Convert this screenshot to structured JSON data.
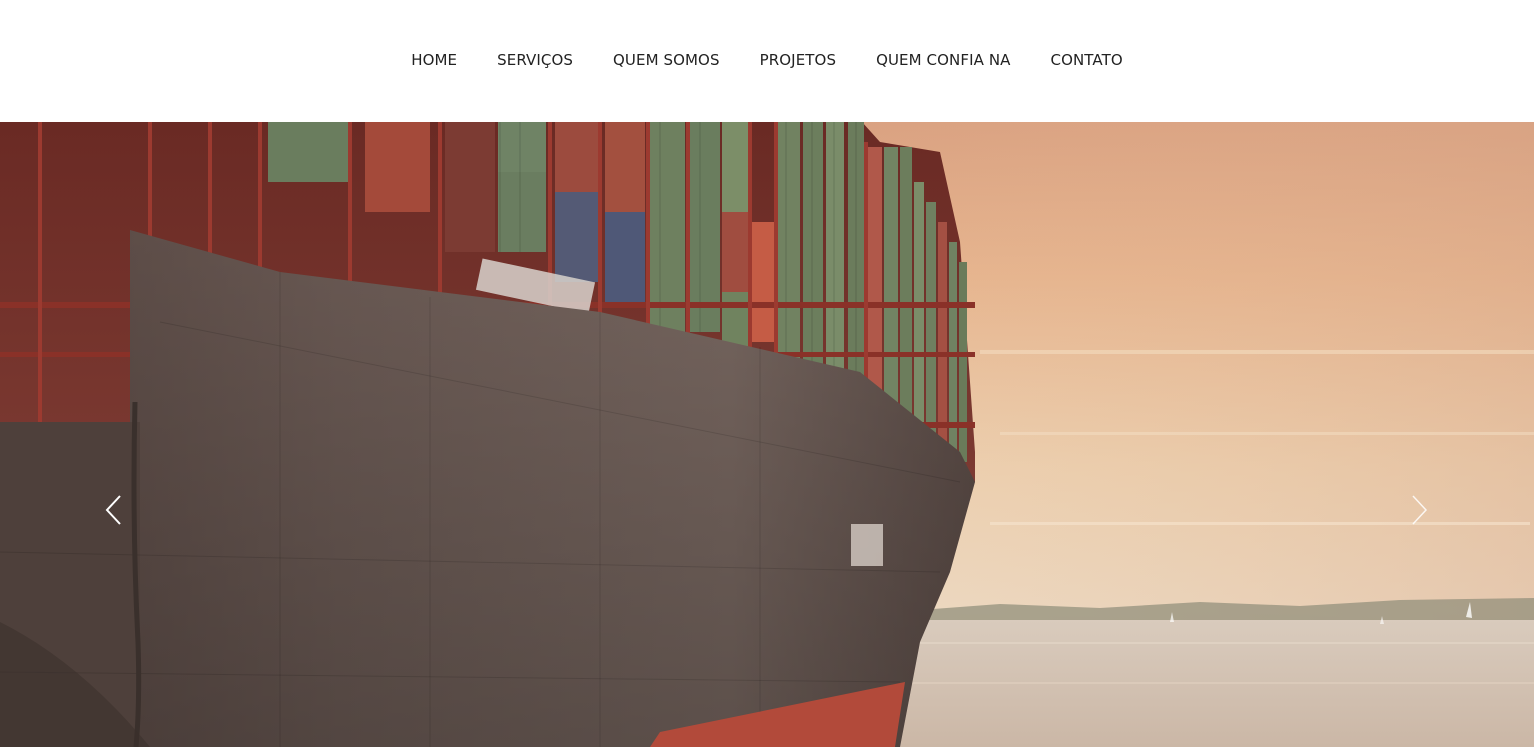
{
  "nav": {
    "items": [
      {
        "label": "HOME"
      },
      {
        "label": "SERVIÇOS"
      },
      {
        "label": "QUEM SOMOS"
      },
      {
        "label": "PROJETOS"
      },
      {
        "label": "QUEM CONFIA NA"
      },
      {
        "label": "CONTATO"
      }
    ]
  },
  "hero": {
    "image": "container-ship-sunset",
    "prev_icon": "chevron-left-icon",
    "next_icon": "chevron-right-icon"
  }
}
